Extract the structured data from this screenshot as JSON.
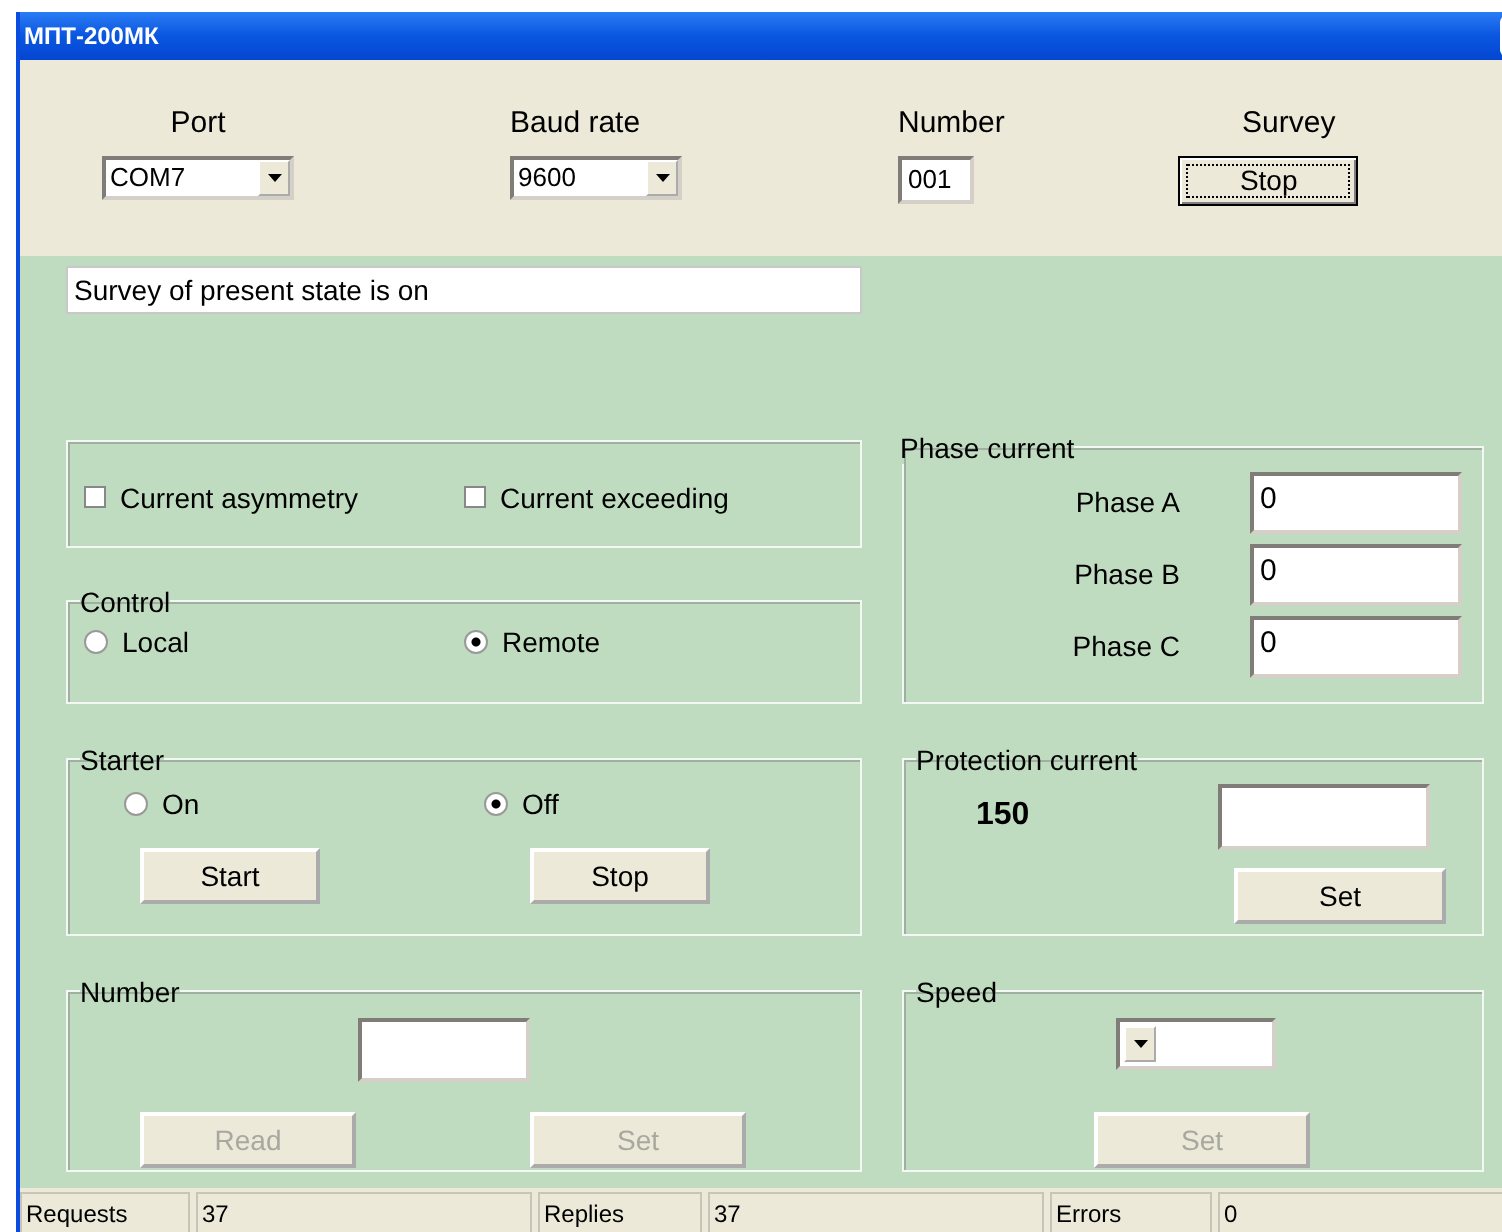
{
  "window": {
    "title": "МПТ-200МК"
  },
  "connection": {
    "port": {
      "label": "Port",
      "value": "COM7"
    },
    "baud_rate": {
      "label": "Baud rate",
      "value": "9600"
    },
    "number": {
      "label": "Number",
      "value": "001"
    },
    "survey": {
      "label": "Survey",
      "button": "Stop"
    }
  },
  "status_message": "Survey of present state is on",
  "alarms": [
    {
      "label": "Current asymmetry",
      "checked": false
    },
    {
      "label": "Current exceeding",
      "checked": false
    }
  ],
  "control": {
    "title": "Control",
    "options": [
      {
        "label": "Local",
        "selected": false
      },
      {
        "label": "Remote",
        "selected": true
      }
    ]
  },
  "starter": {
    "title": "Starter",
    "options": [
      {
        "label": "On",
        "selected": false
      },
      {
        "label": "Off",
        "selected": true
      }
    ],
    "buttons": [
      {
        "label": "Start",
        "disabled": false
      },
      {
        "label": "Stop",
        "disabled": false
      }
    ]
  },
  "number": {
    "title": "Number",
    "buttons": [
      {
        "label": "Read",
        "disabled": true
      },
      {
        "label": "Set",
        "disabled": true
      }
    ]
  },
  "phase_current": {
    "title": "Phase current",
    "phases": [
      {
        "label": "Phase A",
        "value": "0"
      },
      {
        "label": "Phase B",
        "value": "0"
      },
      {
        "label": "Phase C",
        "value": "0"
      }
    ]
  },
  "protection_current": {
    "title": "Protection current",
    "value": "150",
    "button": {
      "label": "Set",
      "disabled": false
    }
  },
  "speed": {
    "title": "Speed",
    "button": {
      "label": "Set",
      "disabled": true
    }
  },
  "status_bar": [
    {
      "label": "Requests",
      "value": "37"
    },
    {
      "label": "Replies",
      "value": "37"
    },
    {
      "label": "Errors",
      "value": "0"
    }
  ]
}
